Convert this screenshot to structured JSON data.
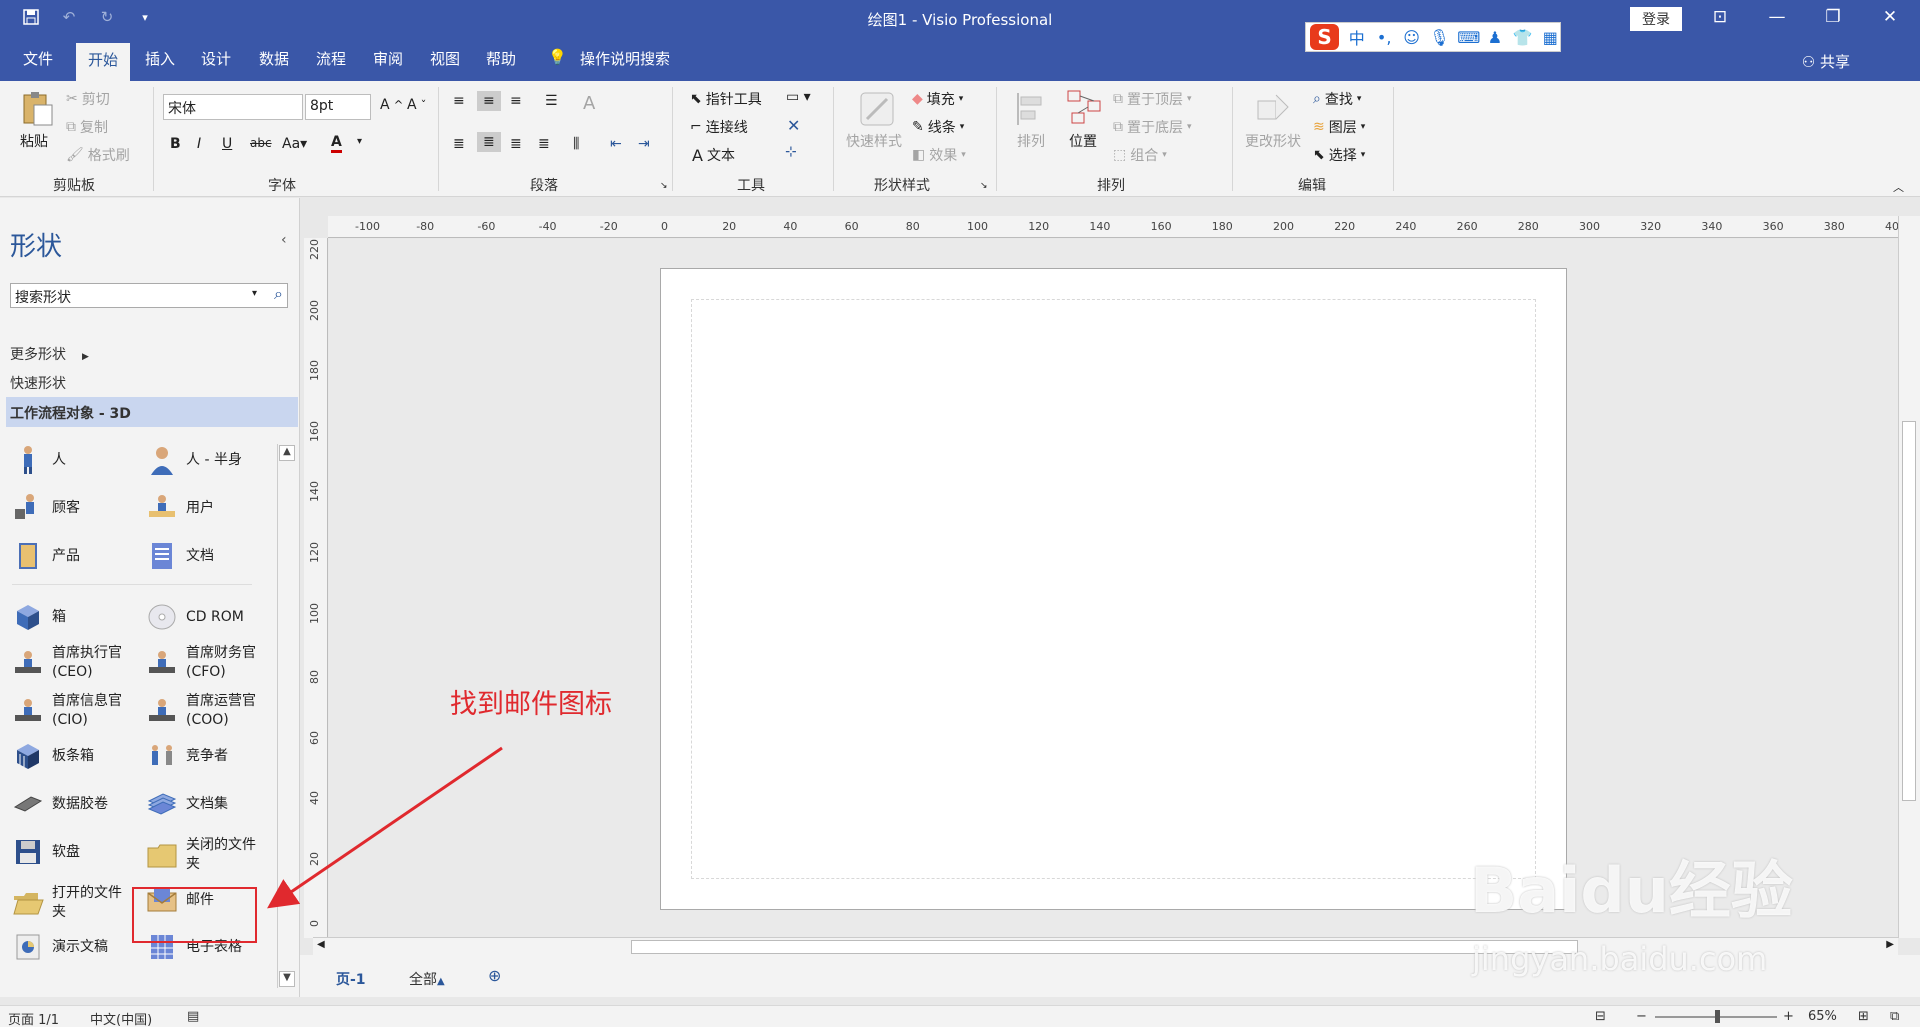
{
  "window": {
    "title": "绘图1  -  Visio Professional",
    "login": "登录"
  },
  "menu": {
    "tabs": [
      "文件",
      "开始",
      "插入",
      "设计",
      "数据",
      "流程",
      "审阅",
      "视图",
      "帮助"
    ],
    "tell_me": "操作说明搜索",
    "share": "共享"
  },
  "ribbon": {
    "clipboard": {
      "paste": "粘贴",
      "cut": "剪切",
      "copy": "复制",
      "format_painter": "格式刷",
      "label": "剪贴板"
    },
    "font": {
      "name": "宋体",
      "size": "8pt",
      "label": "字体"
    },
    "paragraph": {
      "label": "段落"
    },
    "tools": {
      "pointer": "指针工具",
      "connector": "连接线",
      "text": "文本",
      "label": "工具"
    },
    "shape_styles": {
      "quick_styles": "快速样式",
      "fill": "填充",
      "line": "线条",
      "effects": "效果",
      "label": "形状样式"
    },
    "arrange": {
      "align": "排列",
      "position": "位置",
      "bring_front": "置于顶层",
      "send_back": "置于底层",
      "group": "组合",
      "label": "排列"
    },
    "editing": {
      "change_shape": "更改形状",
      "find": "查找",
      "layers": "图层",
      "select": "选择",
      "label": "编辑"
    }
  },
  "shapes_panel": {
    "title": "形状",
    "search_placeholder": "搜索形状",
    "more_shapes": "更多形状",
    "quick_shapes": "快速形状",
    "active_stencil": "工作流程对象 - 3D",
    "items": [
      {
        "label": "人",
        "icon": "person-icon"
      },
      {
        "label": "人 - 半身",
        "icon": "person-half-icon"
      },
      {
        "label": "顾客",
        "icon": "customer-icon"
      },
      {
        "label": "用户",
        "icon": "user-icon"
      },
      {
        "label": "产品",
        "icon": "product-icon"
      },
      {
        "label": "文档",
        "icon": "document-icon"
      },
      {
        "label": "箱",
        "icon": "box-icon"
      },
      {
        "label": "CD ROM",
        "icon": "cd-rom-icon"
      },
      {
        "label": "首席执行官 (CEO)",
        "icon": "ceo-icon"
      },
      {
        "label": "首席财务官 (CFO)",
        "icon": "cfo-icon"
      },
      {
        "label": "首席信息官 (CIO)",
        "icon": "cio-icon"
      },
      {
        "label": "首席运营官 (COO)",
        "icon": "coo-icon"
      },
      {
        "label": "板条箱",
        "icon": "crate-icon"
      },
      {
        "label": "竞争者",
        "icon": "competitor-icon"
      },
      {
        "label": "数据胶卷",
        "icon": "data-film-icon"
      },
      {
        "label": "文档集",
        "icon": "document-set-icon"
      },
      {
        "label": "软盘",
        "icon": "floppy-icon"
      },
      {
        "label": "关闭的文件夹",
        "icon": "closed-folder-icon"
      },
      {
        "label": "打开的文件夹",
        "icon": "open-folder-icon"
      },
      {
        "label": "邮件",
        "icon": "mail-icon"
      },
      {
        "label": "演示文稿",
        "icon": "presentation-icon"
      },
      {
        "label": "电子表格",
        "icon": "spreadsheet-icon"
      }
    ]
  },
  "rulers": {
    "horizontal": [
      "-100",
      "-80",
      "-60",
      "-40",
      "-20",
      "0",
      "20",
      "40",
      "60",
      "80",
      "100",
      "120",
      "140",
      "160",
      "180",
      "200",
      "220",
      "240",
      "260",
      "280",
      "300",
      "320",
      "340",
      "360",
      "380",
      "40"
    ],
    "vertical": [
      "220",
      "200",
      "180",
      "160",
      "140",
      "120",
      "100",
      "80",
      "60",
      "40",
      "20",
      "0"
    ]
  },
  "page_tabs": {
    "page1": "页-1",
    "all": "全部"
  },
  "status": {
    "page": "页面 1/1",
    "language": "中文(中国)",
    "zoom": "65%",
    "zoom_value_percent": 65
  },
  "annotation": "找到邮件图标",
  "watermark": {
    "logo": "Baidu经验",
    "url": "jingyan.baidu.com"
  },
  "colors": {
    "accent": "#3a57a8",
    "highlight": "#e0292e",
    "selected_stencil": "#c9d6ef"
  }
}
